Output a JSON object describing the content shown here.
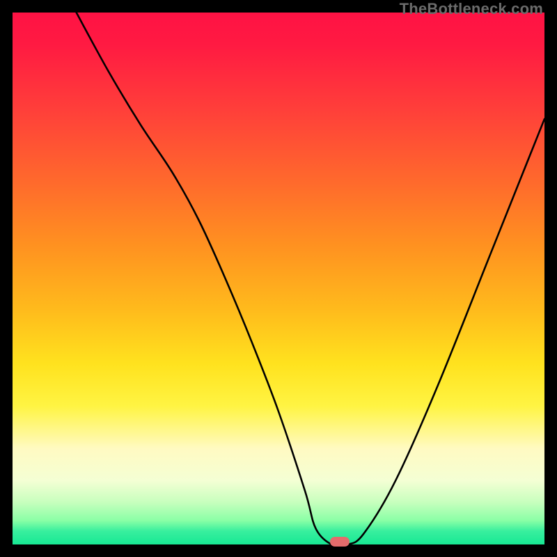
{
  "attribution": {
    "label": "TheBottleneck.com"
  },
  "chart_data": {
    "type": "line",
    "title": "",
    "xlabel": "",
    "ylabel": "",
    "xlim": [
      0,
      100
    ],
    "ylim": [
      0,
      100
    ],
    "grid": false,
    "legend": false,
    "series": [
      {
        "name": "bottleneck-curve",
        "color": "#000000",
        "x": [
          12,
          18,
          24,
          30,
          35,
          40,
          45,
          50,
          55,
          57,
          60,
          63,
          66,
          72,
          80,
          90,
          100
        ],
        "values": [
          100,
          89,
          79,
          70,
          61,
          50,
          38,
          25,
          10,
          3,
          0,
          0,
          2,
          12,
          30,
          55,
          80
        ]
      }
    ],
    "marker": {
      "name": "optimal-point",
      "x": 61.5,
      "y": 0,
      "color": "#e46c6c"
    },
    "background": {
      "type": "vertical-gradient",
      "stops": [
        {
          "pos": 0,
          "color": "#ff1244"
        },
        {
          "pos": 0.18,
          "color": "#ff3e3a"
        },
        {
          "pos": 0.32,
          "color": "#ff6a2c"
        },
        {
          "pos": 0.56,
          "color": "#ffbb1c"
        },
        {
          "pos": 0.74,
          "color": "#fff443"
        },
        {
          "pos": 0.88,
          "color": "#f4ffd4"
        },
        {
          "pos": 1.0,
          "color": "#17e894"
        }
      ]
    }
  }
}
